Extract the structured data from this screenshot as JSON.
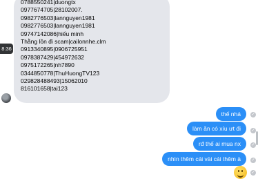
{
  "incoming": {
    "timestamp": "8:36",
    "lines": [
      "0788550241|duongtx",
      "0977674705|28102007.",
      "0982776503|lannguyen1981",
      "0982776503|lannguyen1981",
      "09747142086|hiếu minh",
      "Thằng lồn đi scam|cailonnhe.clm",
      "0913340895|0906725951",
      "0978387429|454972632",
      "0975172265|nh7890",
      "0344850778|ThuHuongTV123",
      "029828488493|15062010",
      "816101658|tai123"
    ]
  },
  "outgoing": [
    {
      "text": "thế nhá"
    },
    {
      "text": "làm ăn có xíu ưt đi"
    },
    {
      "text": "rđ thế ai mua nx"
    },
    {
      "text": "nhìn thêm cái vài cái thêm à"
    }
  ],
  "emoji": "smiling-face-emoji",
  "colors": {
    "outgoing_bubble": "#2b8ff7",
    "incoming_bubble": "#e4e6eb",
    "tooltip": "#323436"
  }
}
